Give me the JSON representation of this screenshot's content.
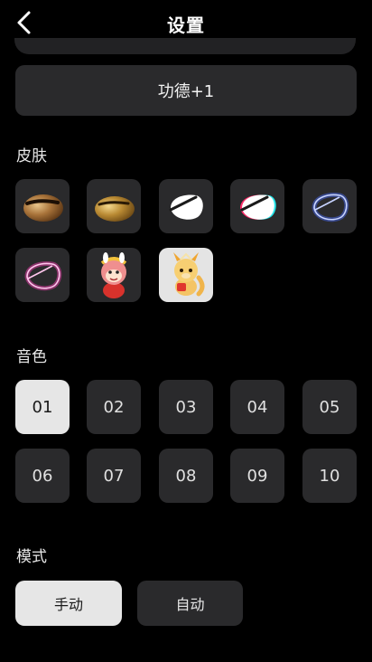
{
  "header": {
    "title": "设置",
    "back_icon": "chevron-left-icon"
  },
  "merit": {
    "text": "功德+1"
  },
  "skins": {
    "label": "皮肤",
    "items": [
      {
        "icon": "bronze-wooden-fish-icon",
        "variant": "bronze"
      },
      {
        "icon": "gold-wooden-fish-icon",
        "variant": "gold"
      },
      {
        "icon": "white-wooden-fish-icon",
        "variant": "white"
      },
      {
        "icon": "glitch-wooden-fish-icon",
        "variant": "glitch"
      },
      {
        "icon": "blue-neon-wooden-fish-icon",
        "variant": "blue-neon"
      },
      {
        "icon": "pink-neon-wooden-fish-icon",
        "variant": "pink-neon"
      },
      {
        "icon": "monkey-character-icon",
        "variant": "monkey"
      },
      {
        "icon": "dragon-character-icon",
        "variant": "dragon"
      }
    ]
  },
  "tones": {
    "label": "音色",
    "items": [
      "01",
      "02",
      "03",
      "04",
      "05",
      "06",
      "07",
      "08",
      "09",
      "10"
    ],
    "selected": "01"
  },
  "modes": {
    "label": "模式",
    "items": [
      "手动",
      "自动"
    ],
    "selected": "手动"
  },
  "colors": {
    "background": "#000000",
    "tile": "#2a2a2c",
    "selected": "#e6e6e6",
    "blue_neon": "#4a6cff",
    "pink_neon": "#ff3fb8"
  }
}
